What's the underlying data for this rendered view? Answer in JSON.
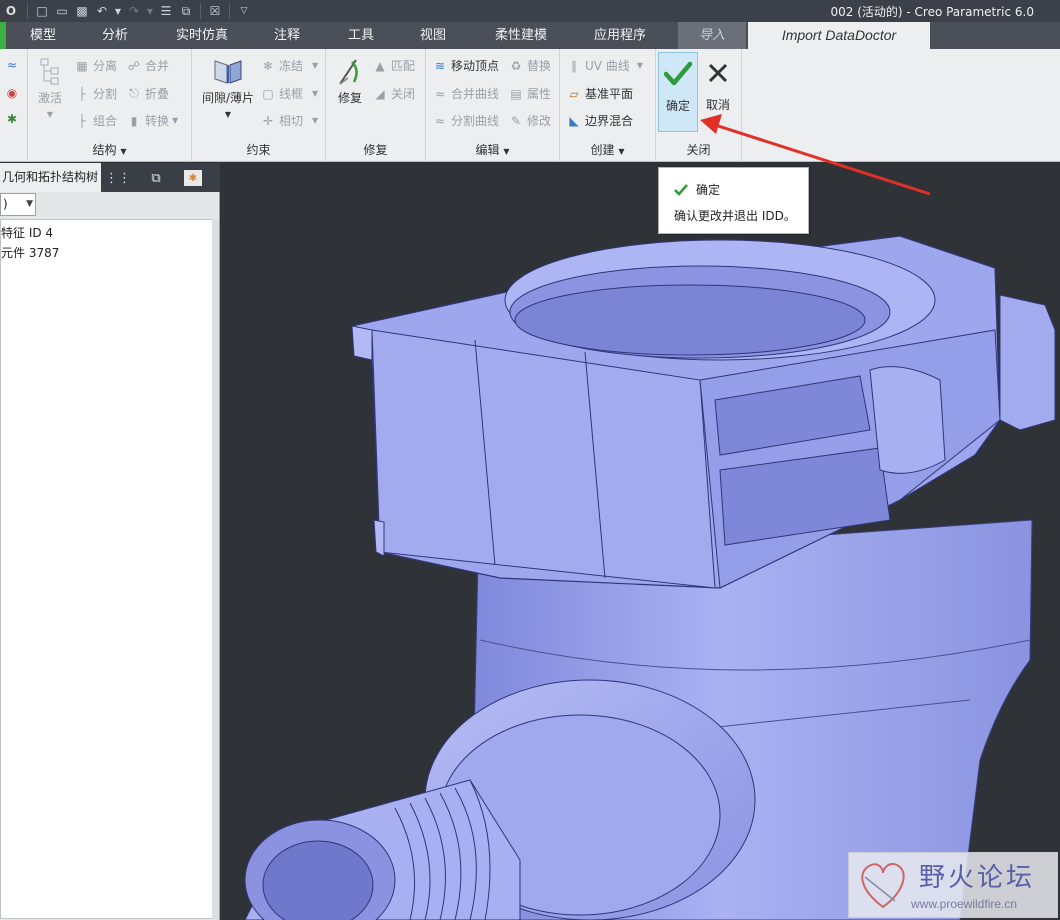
{
  "window": {
    "title": "002 (活动的) - Creo Parametric 6.0",
    "app_logo_text": "O"
  },
  "tabs": [
    {
      "label": "模型"
    },
    {
      "label": "分析"
    },
    {
      "label": "实时仿真"
    },
    {
      "label": "注释"
    },
    {
      "label": "工具"
    },
    {
      "label": "视图"
    },
    {
      "label": "柔性建模"
    },
    {
      "label": "应用程序"
    },
    {
      "label": "导入"
    },
    {
      "label": "Import DataDoctor"
    }
  ],
  "ribbon": {
    "structure": {
      "label": "结构",
      "activate": "激活",
      "separate": "分离",
      "split": "分割",
      "group": "组合",
      "merge": "合并",
      "fold": "折叠",
      "convert": "转换"
    },
    "constraint": {
      "label": "约束",
      "gap_sheet": "间隙/薄片",
      "freeze": "冻结",
      "wireframe": "线框",
      "tangent": "相切"
    },
    "repair": {
      "label": "修复",
      "repair": "修复",
      "match": "匹配",
      "close": "关闭"
    },
    "edit": {
      "label": "编辑",
      "move_vertex": "移动顶点",
      "merge_curve": "合并曲线",
      "split_curve": "分割曲线",
      "replace": "替换",
      "attribute": "属性",
      "modify": "修改"
    },
    "create": {
      "label": "创建",
      "uv_curve": "UV 曲线",
      "datum_plane": "基准平面",
      "boundary_blend": "边界混合"
    },
    "close": {
      "label": "关闭",
      "ok": "确定",
      "cancel": "取消"
    }
  },
  "tooltip": {
    "title": "确定",
    "description": "确认更改并退出 IDD。"
  },
  "left_panel": {
    "tab_label": "几何和拓扑结构树",
    "filter_value": ")",
    "tree_items": [
      "特征 ID 4",
      "元件 3787"
    ]
  },
  "watermark": {
    "text": "野火论坛",
    "url": "www.proewildfire.cn"
  },
  "colors": {
    "accent_green": "#3cb043",
    "part_color": "#9aa3ec",
    "background": "#2f3338",
    "arrow_red": "#e03028"
  }
}
